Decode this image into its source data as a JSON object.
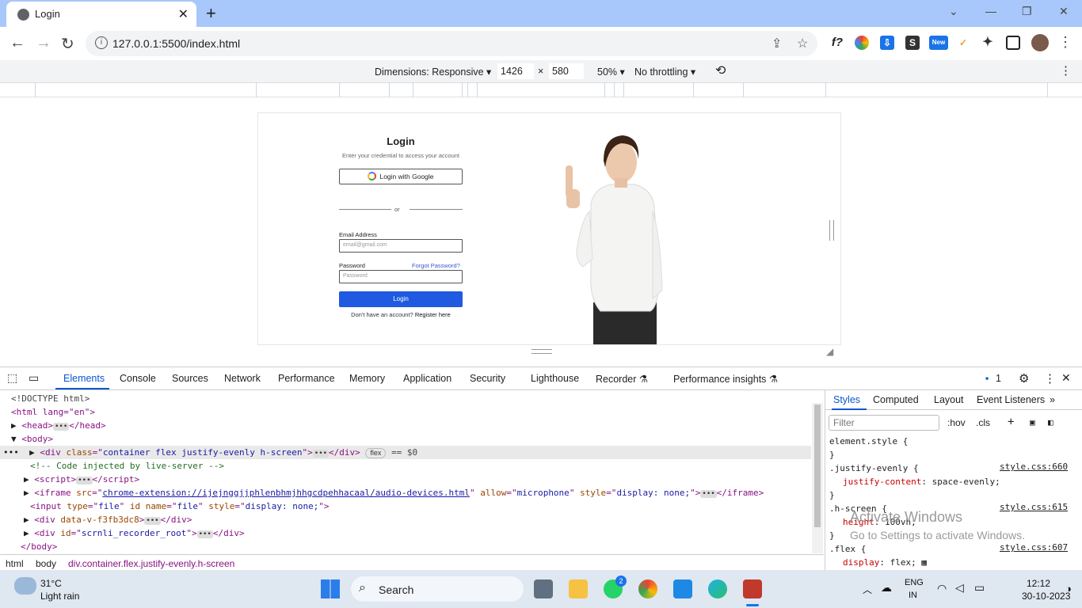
{
  "tab": {
    "title": "Login",
    "close": "✕",
    "new": "+"
  },
  "window": {
    "minimize": "—",
    "restore": "❐",
    "close": "✕",
    "tabsearch": "⌄"
  },
  "address": {
    "url": "127.0.0.1:5500/index.html"
  },
  "extensions": [
    "f?",
    "S",
    "New"
  ],
  "devicebar": {
    "dimensions_label": "Dimensions: Responsive ▾",
    "width": "1426",
    "times": "×",
    "height": "580",
    "zoom": "50% ▾",
    "throttling": "No throttling ▾"
  },
  "login": {
    "title": "Login",
    "subtitle": "Enter your credential to access your account",
    "google_button": "Login with Google",
    "or": "or",
    "email_label": "Email Address",
    "email_placeholder": "email@gmail.com",
    "password_label": "Password",
    "forgot": "Forgot Password?",
    "password_placeholder": "Password",
    "login_button": "Login",
    "register_prefix": "Don't have an account? ",
    "register_link": "Register here"
  },
  "devtools": {
    "tabs": [
      "Elements",
      "Console",
      "Sources",
      "Network",
      "Performance",
      "Memory",
      "Application",
      "Security",
      "Lighthouse",
      "Recorder ⚗",
      "Performance insights ⚗"
    ],
    "issues_count": "1",
    "styles_tabs": [
      "Styles",
      "Computed",
      "Layout",
      "Event Listeners",
      "»"
    ],
    "filter_placeholder": "Filter",
    "hov": ":hov",
    "cls": ".cls",
    "breadcrumbs": [
      "html",
      "body",
      "div.container.flex.justify-evenly.h-screen"
    ],
    "dom": {
      "doctype": "<!DOCTYPE html>",
      "html_open": "<html lang=\"en\">",
      "head": "<head>",
      "head_close": "</head>",
      "body": "<body>",
      "div_class": "container flex justify-evenly h-screen",
      "flex_badge": "flex",
      "eq": "== $0",
      "comment": "<!-- Code injected by live-server -->",
      "iframe_src": "chrome-extension://ijejnggjjphlenbhmjhhgcdpehhacaal/audio-devices.html",
      "iframe_allow": "microphone",
      "iframe_style": "display: none;",
      "input_style": "display: none;",
      "div_data": "data-v-f3fb3dc8",
      "div_id": "scrnli_recorder_root",
      "body_close": "</body>"
    },
    "rules": [
      {
        "selector": "element.style {",
        "prop": "",
        "value": "",
        "source": ""
      },
      {
        "selector": ".justify-evenly {",
        "prop": "justify-content",
        "value": "space-evenly;",
        "source": "style.css:660"
      },
      {
        "selector": ".h-screen {",
        "prop": "height",
        "value": "100vh;",
        "source": "style.css:615"
      },
      {
        "selector": ".flex {",
        "prop": "display",
        "value": "flex;",
        "source": "style.css:607"
      }
    ]
  },
  "watermark": {
    "line1": "Activate Windows",
    "line2": "Go to Settings to activate Windows."
  },
  "taskbar": {
    "weather_temp": "31°C",
    "weather_desc": "Light rain",
    "search": "Search",
    "whatsapp_badge": "2",
    "lang1": "ENG",
    "lang2": "IN",
    "time": "12:12",
    "date": "30-10-2023"
  },
  "colors": {
    "accent": "#1f5ae0",
    "tabstrip": "#a8c7fa",
    "devtools_active": "#0b57d0"
  }
}
